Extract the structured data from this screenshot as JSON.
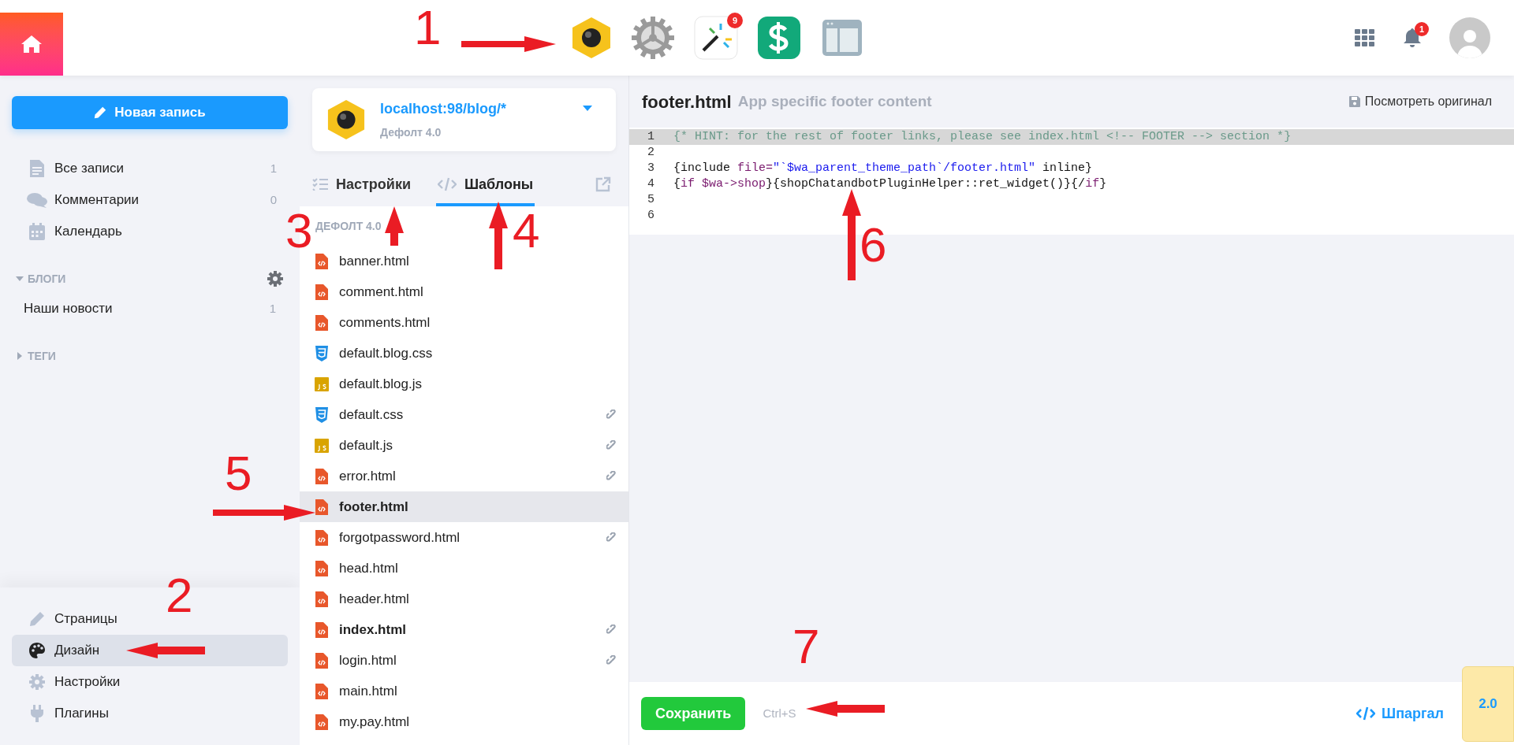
{
  "topbar": {
    "apps": [
      {
        "kind": "blog"
      },
      {
        "kind": "settings"
      },
      {
        "kind": "sparkle",
        "badge": "9"
      },
      {
        "kind": "dollar"
      },
      {
        "kind": "layout"
      }
    ],
    "notifications_badge": "1"
  },
  "sidebar": {
    "new_button": "Новая запись",
    "items": [
      {
        "label": "Все записи",
        "count": "1"
      },
      {
        "label": "Комментарии",
        "count": "0"
      },
      {
        "label": "Календарь"
      }
    ],
    "blogs": {
      "title": "БЛОГИ",
      "expanded": true,
      "items": [
        {
          "label": "Наши новости",
          "count": "1"
        }
      ]
    },
    "tags": {
      "title": "ТЕГИ",
      "expanded": false
    },
    "bottom_items": [
      {
        "label": "Страницы",
        "selected": false
      },
      {
        "label": "Дизайн",
        "selected": true
      },
      {
        "label": "Настройки",
        "selected": false
      },
      {
        "label": "Плагины",
        "selected": false
      }
    ]
  },
  "theme": {
    "site": "localhost:98/blog/*",
    "name": "Дефолт 4.0"
  },
  "tabs": [
    {
      "label": "Настройки",
      "selected": false
    },
    {
      "label": "Шаблоны",
      "selected": true
    }
  ],
  "files": {
    "heading": "ДЕФОЛТ 4.0",
    "items": [
      {
        "kind": "html",
        "name": "banner.html",
        "selected": false,
        "bold": false,
        "linked": false
      },
      {
        "kind": "html",
        "name": "comment.html",
        "selected": false,
        "bold": false,
        "linked": false
      },
      {
        "kind": "html",
        "name": "comments.html",
        "selected": false,
        "bold": false,
        "linked": false
      },
      {
        "kind": "css",
        "name": "default.blog.css",
        "selected": false,
        "bold": false,
        "linked": false
      },
      {
        "kind": "js",
        "name": "default.blog.js",
        "selected": false,
        "bold": false,
        "linked": false
      },
      {
        "kind": "css",
        "name": "default.css",
        "selected": false,
        "bold": false,
        "linked": true
      },
      {
        "kind": "js",
        "name": "default.js",
        "selected": false,
        "bold": false,
        "linked": true
      },
      {
        "kind": "html",
        "name": "error.html",
        "selected": false,
        "bold": false,
        "linked": true
      },
      {
        "kind": "html",
        "name": "footer.html",
        "selected": true,
        "bold": true,
        "linked": false
      },
      {
        "kind": "html",
        "name": "forgotpassword.html",
        "selected": false,
        "bold": false,
        "linked": true
      },
      {
        "kind": "html",
        "name": "head.html",
        "selected": false,
        "bold": false,
        "linked": false
      },
      {
        "kind": "html",
        "name": "header.html",
        "selected": false,
        "bold": false,
        "linked": false
      },
      {
        "kind": "html",
        "name": "index.html",
        "selected": false,
        "bold": true,
        "linked": true
      },
      {
        "kind": "html",
        "name": "login.html",
        "selected": false,
        "bold": false,
        "linked": true
      },
      {
        "kind": "html",
        "name": "main.html",
        "selected": false,
        "bold": false,
        "linked": false
      },
      {
        "kind": "html",
        "name": "my.pay.html",
        "selected": false,
        "bold": false,
        "linked": false
      }
    ]
  },
  "editor": {
    "title": "footer.html",
    "subtitle": "App specific footer content",
    "view_original": "Посмотреть оригинал",
    "lines": [
      {
        "number": "1",
        "highlighted": true,
        "tokens": [
          {
            "kind": "comment",
            "text": "{* HINT: for the rest of footer links, please see index.html <!-- FOOTER --> section *}"
          }
        ]
      },
      {
        "number": "2",
        "highlighted": false
      },
      {
        "number": "3",
        "highlighted": false,
        "tokens": [
          {
            "kind": "plain",
            "text": "{include "
          },
          {
            "kind": "keyword",
            "text": "file="
          },
          {
            "kind": "string",
            "text": "\"`$wa_parent_theme_path`/footer.html\""
          },
          {
            "kind": "plain",
            "text": " inline}"
          }
        ]
      },
      {
        "number": "4",
        "highlighted": false,
        "tokens": [
          {
            "kind": "plain",
            "text": "{"
          },
          {
            "kind": "keyword",
            "text": "if $wa->shop"
          },
          {
            "kind": "plain",
            "text": "}{shopChatandbotPluginHelper::ret_widget()}{/"
          },
          {
            "kind": "keyword",
            "text": "if"
          },
          {
            "kind": "plain",
            "text": "}"
          }
        ]
      },
      {
        "number": "5",
        "highlighted": false
      },
      {
        "number": "6",
        "highlighted": false
      }
    ],
    "save_button": "Сохранить",
    "shortcut": "Ctrl+S",
    "cheatsheet": "Шпаргал",
    "version": "2.0"
  },
  "annotations": [
    {
      "label": "1"
    },
    {
      "label": "2"
    },
    {
      "label": "3"
    },
    {
      "label": "4"
    },
    {
      "label": "5"
    },
    {
      "label": "6"
    },
    {
      "label": "7"
    }
  ]
}
